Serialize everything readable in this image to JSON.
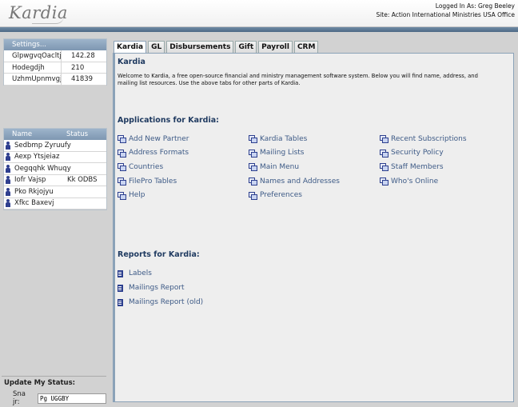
{
  "header": {
    "logo": "Kardia",
    "logged_in": "Logged In As: Greg Beeley",
    "site": "Site: Action International Ministries USA Office"
  },
  "settings": {
    "title": "Settings...",
    "rows": [
      {
        "key": "GlpwgvqOacltjl",
        "value": "142.28"
      },
      {
        "key": "Hodegdjh",
        "value": "210"
      },
      {
        "key": "UzhmUpnmvgj",
        "value": "41839"
      }
    ]
  },
  "status_list": {
    "col_name": "Name",
    "col_status": "Status",
    "rows": [
      {
        "name": "Sedbmp Zyruufy",
        "status": ""
      },
      {
        "name": "Aexp Ytsjeiaz",
        "status": ""
      },
      {
        "name": "Oegqqhk Whuqy",
        "status": ""
      },
      {
        "name": "Iofr Vajsp",
        "status": "Kk ODBS"
      },
      {
        "name": "Pko Rkjojyu",
        "status": ""
      },
      {
        "name": "Xfkc Baxevj",
        "status": ""
      }
    ]
  },
  "update_status": {
    "title": "Update My Status:",
    "label": "Sna jr:",
    "value": "Pg UGGBY"
  },
  "tabs": [
    "Kardia",
    "GL",
    "Disbursements",
    "Gift",
    "Payroll",
    "CRM"
  ],
  "panel": {
    "title": "Kardia",
    "welcome": "Welcome to Kardia, a free open-source financial and ministry management software system. Below you will find name, address, and mailing list resources. Use the above tabs for other parts of Kardia.",
    "apps_title": "Applications for Kardia:",
    "apps_col1": [
      "Add New Partner",
      "Address Formats",
      "Countries",
      "FilePro Tables",
      "Help"
    ],
    "apps_col2": [
      "Kardia Tables",
      "Mailing Lists",
      "Main Menu",
      "Names and Addresses",
      "Preferences"
    ],
    "apps_col3": [
      "Recent Subscriptions",
      "Security Policy",
      "Staff Members",
      "Who's Online"
    ],
    "reports_title": "Reports for Kardia:",
    "reports": [
      "Labels",
      "Mailings Report",
      "Mailings Report (old)"
    ]
  },
  "icons": {
    "app_icon": "window-stack-icon",
    "report_icon": "document-icon",
    "person_icon": "person-icon"
  },
  "colors": {
    "accent": "#4e6a87",
    "link": "#3d5a86",
    "heading": "#1f3a60"
  }
}
